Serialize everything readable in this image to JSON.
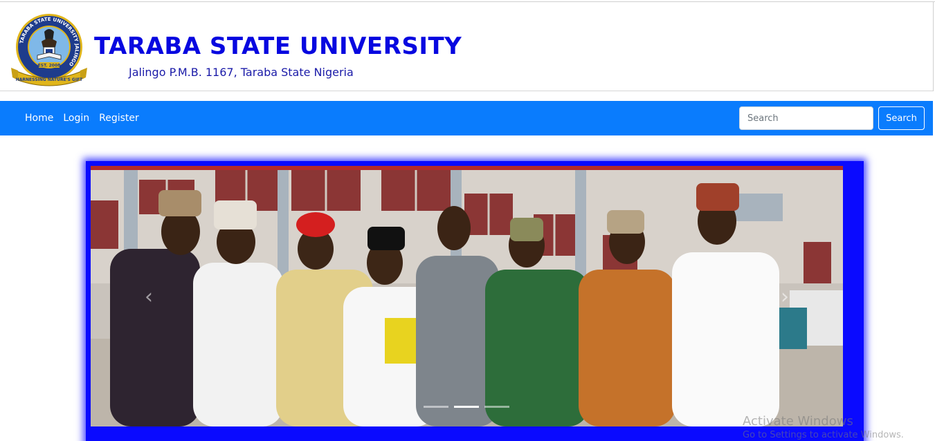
{
  "header": {
    "title": "TARABA STATE UNIVERSITY",
    "subtitle": "Jalingo P.M.B. 1167, Taraba State Nigeria",
    "logo": {
      "icon": "university-seal",
      "ring_text": "TARABA STATE UNIVERSITY JALINGO",
      "banner_text": "HARNESSING NATURE'S GIFT",
      "est": "EST. 2008",
      "colors": {
        "ring": "#1e3c8c",
        "gold": "#e0b51a",
        "inner": "#7fb8e8"
      }
    }
  },
  "navbar": {
    "links": [
      {
        "label": "Home"
      },
      {
        "label": "Login"
      },
      {
        "label": "Register"
      }
    ],
    "search": {
      "placeholder": "Search",
      "value": ""
    },
    "search_button": "Search",
    "color": "#0a7cfd"
  },
  "carousel": {
    "image": "group-photo-graduates",
    "prev_icon": "chevron-left-icon",
    "next_icon": "chevron-right-icon",
    "indicators": 3,
    "active_indicator": 1,
    "frame_color": "#0a0aff"
  },
  "os_watermark": {
    "line1": "Activate Windows",
    "line2": "Go to Settings to activate Windows."
  },
  "colors": {
    "title": "#0707e0",
    "subtitle": "#1a1aa8"
  }
}
